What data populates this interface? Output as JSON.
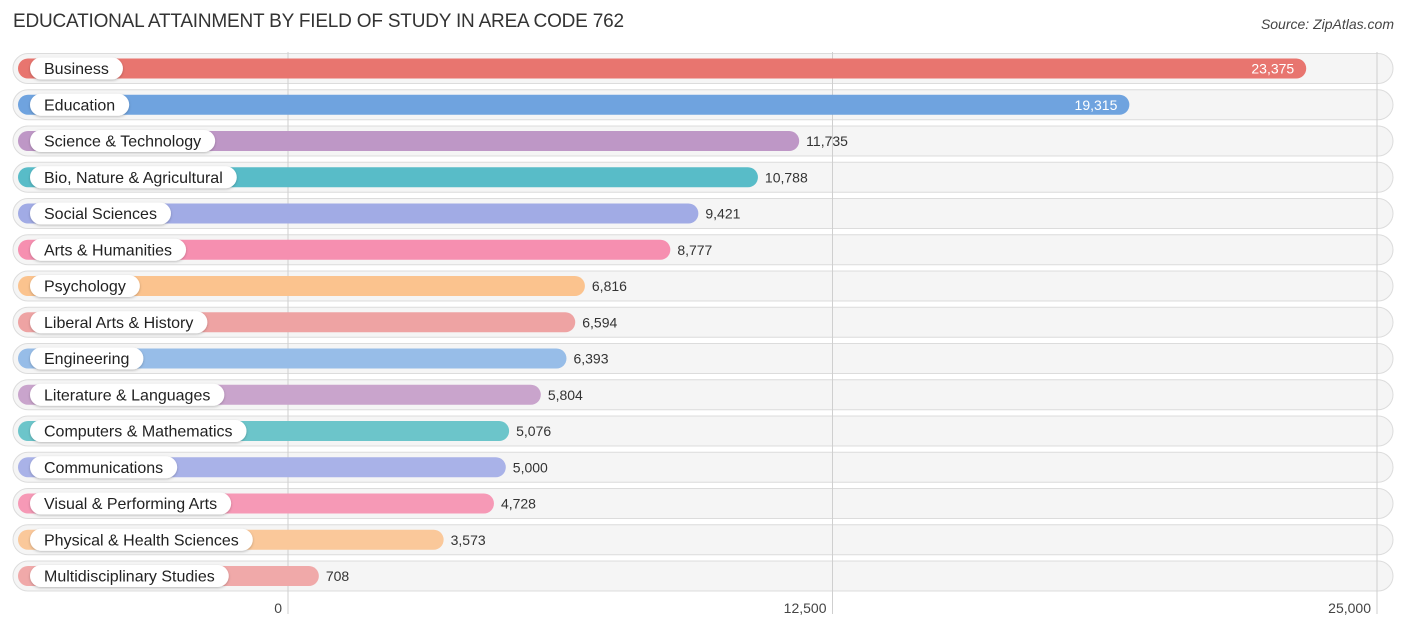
{
  "header": {
    "title": "EDUCATIONAL ATTAINMENT BY FIELD OF STUDY IN AREA CODE 762",
    "source": "Source: ZipAtlas.com"
  },
  "chart_data": {
    "type": "bar",
    "orientation": "horizontal",
    "title": "EDUCATIONAL ATTAINMENT BY FIELD OF STUDY IN AREA CODE 762",
    "xlabel": "",
    "ylabel": "",
    "xlim": [
      0,
      25000
    ],
    "grid": true,
    "ticks": [
      {
        "value": 0,
        "label": "0"
      },
      {
        "value": 12500,
        "label": "12,500"
      },
      {
        "value": 25000,
        "label": "25,000"
      }
    ],
    "categories": [
      "Business",
      "Education",
      "Science & Technology",
      "Bio, Nature & Agricultural",
      "Social Sciences",
      "Arts & Humanities",
      "Psychology",
      "Liberal Arts & History",
      "Engineering",
      "Literature & Languages",
      "Computers & Mathematics",
      "Communications",
      "Visual & Performing Arts",
      "Physical & Health Sciences",
      "Multidisciplinary Studies"
    ],
    "values": [
      23375,
      19315,
      11735,
      10788,
      9421,
      8777,
      6816,
      6594,
      6393,
      5804,
      5076,
      5000,
      4728,
      3573,
      708
    ],
    "value_labels": [
      "23,375",
      "19,315",
      "11,735",
      "10,788",
      "9,421",
      "8,777",
      "6,816",
      "6,594",
      "6,393",
      "5,804",
      "5,076",
      "5,000",
      "4,728",
      "3,573",
      "708"
    ],
    "colors": [
      "#e8756f",
      "#6fa3df",
      "#be97c6",
      "#58bcc8",
      "#a1abe5",
      "#f68fb0",
      "#fbc38e",
      "#eea3a3",
      "#97bde8",
      "#c9a4cc",
      "#6cc5ca",
      "#a9b2e8",
      "#f699b6",
      "#fac89a",
      "#f0a9a9"
    ]
  }
}
